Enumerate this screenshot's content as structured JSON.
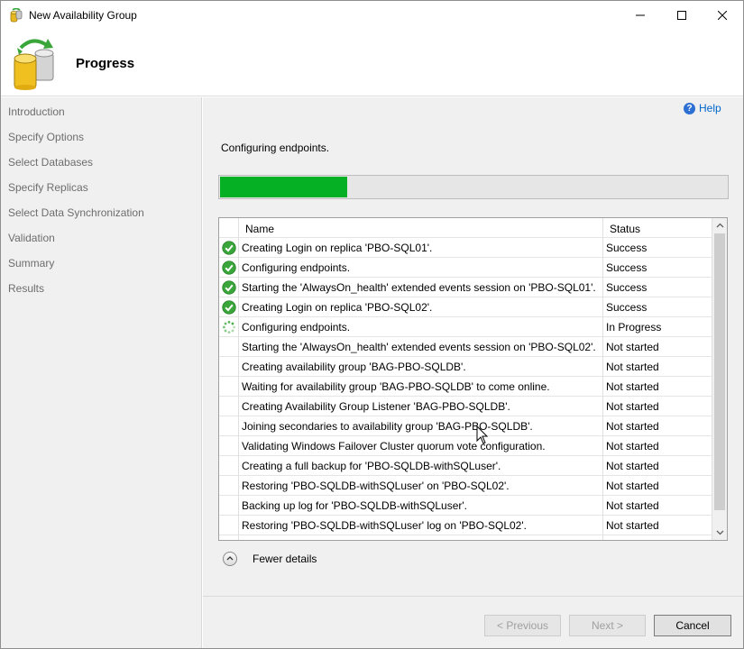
{
  "window": {
    "title": "New Availability Group",
    "heading": "Progress"
  },
  "nav": {
    "items": [
      {
        "label": "Introduction"
      },
      {
        "label": "Specify Options"
      },
      {
        "label": "Select Databases"
      },
      {
        "label": "Specify Replicas"
      },
      {
        "label": "Select Data Synchronization"
      },
      {
        "label": "Validation"
      },
      {
        "label": "Summary"
      },
      {
        "label": "Results"
      }
    ]
  },
  "main": {
    "help_label": "Help",
    "status_text": "Configuring endpoints.",
    "progress_fraction": 0.25,
    "progress_color": "#06b025",
    "columns": {
      "name": "Name",
      "status": "Status"
    },
    "rows": [
      {
        "icon": "success-check-icon",
        "name": "Creating Login on replica 'PBO-SQL01'.",
        "status": "Success"
      },
      {
        "icon": "success-check-icon",
        "name": "Configuring endpoints.",
        "status": "Success"
      },
      {
        "icon": "success-check-icon",
        "name": "Starting the 'AlwaysOn_health' extended events session on 'PBO-SQL01'.",
        "status": "Success"
      },
      {
        "icon": "success-check-icon",
        "name": "Creating Login on replica 'PBO-SQL02'.",
        "status": "Success"
      },
      {
        "icon": "in-progress-spinner-icon",
        "name": "Configuring endpoints.",
        "status": "In Progress"
      },
      {
        "icon": "",
        "name": "Starting the 'AlwaysOn_health' extended events session on 'PBO-SQL02'.",
        "status": "Not started"
      },
      {
        "icon": "",
        "name": "Creating availability group 'BAG-PBO-SQLDB'.",
        "status": "Not started"
      },
      {
        "icon": "",
        "name": "Waiting for availability group 'BAG-PBO-SQLDB' to come online.",
        "status": "Not started"
      },
      {
        "icon": "",
        "name": "Creating Availability Group Listener 'BAG-PBO-SQLDB'.",
        "status": "Not started"
      },
      {
        "icon": "",
        "name": "Joining secondaries to availability group 'BAG-PBO-SQLDB'.",
        "status": "Not started"
      },
      {
        "icon": "",
        "name": "Validating Windows Failover Cluster quorum vote configuration.",
        "status": "Not started"
      },
      {
        "icon": "",
        "name": "Creating a full backup for 'PBO-SQLDB-withSQLuser'.",
        "status": "Not started"
      },
      {
        "icon": "",
        "name": "Restoring 'PBO-SQLDB-withSQLuser' on 'PBO-SQL02'.",
        "status": "Not started"
      },
      {
        "icon": "",
        "name": "Backing up log for 'PBO-SQLDB-withSQLuser'.",
        "status": "Not started"
      },
      {
        "icon": "",
        "name": "Restoring 'PBO-SQLDB-withSQLuser' log on 'PBO-SQL02'.",
        "status": "Not started"
      }
    ],
    "details_label": "Fewer details"
  },
  "footer": {
    "previous_label": "< Previous",
    "next_label": "Next >",
    "cancel_label": "Cancel"
  }
}
